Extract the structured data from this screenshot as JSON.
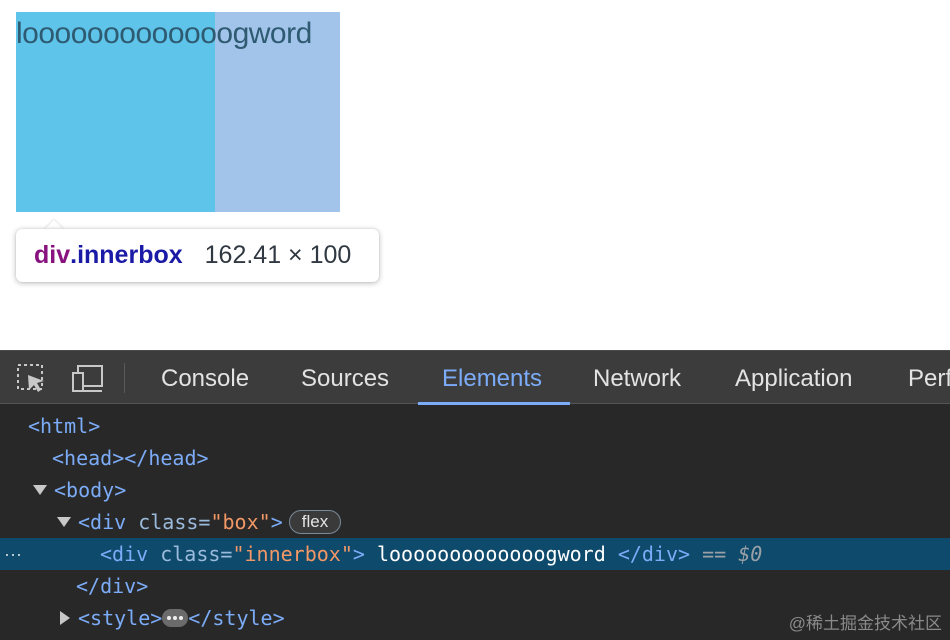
{
  "preview": {
    "inner_text": "looooooooooooogword",
    "tooltip": {
      "tag": "div",
      "class": ".innerbox",
      "size": "162.41 × 100"
    }
  },
  "devtools": {
    "tabs": [
      {
        "label": "Console"
      },
      {
        "label": "Sources"
      },
      {
        "label": "Elements",
        "active": true
      },
      {
        "label": "Network"
      },
      {
        "label": "Application"
      },
      {
        "label": "Perf"
      }
    ],
    "tree": {
      "html_open": "<html>",
      "head": "<head></head>",
      "body_open": "<body>",
      "div_open_start": "<div ",
      "attr_class": "class=",
      "box_value": "\"box\"",
      "tag_close": ">",
      "flex_badge": "flex",
      "innerbox_value": "\"innerbox\"",
      "innerbox_text": " looooooooooooogword ",
      "div_close": "</div>",
      "selected_ref": "$0",
      "eq": " == ",
      "style_open": "<style>",
      "style_close": "</style>",
      "row_dots": "···"
    }
  },
  "watermark": "@稀土掘金技术社区",
  "colors": {
    "box_bg": "#a2c4ea",
    "innerbox_bg": "#5ec4ea",
    "devtools_bg": "#282828",
    "selected_row": "#0e4a6c",
    "active_tab": "#7cacf8"
  }
}
